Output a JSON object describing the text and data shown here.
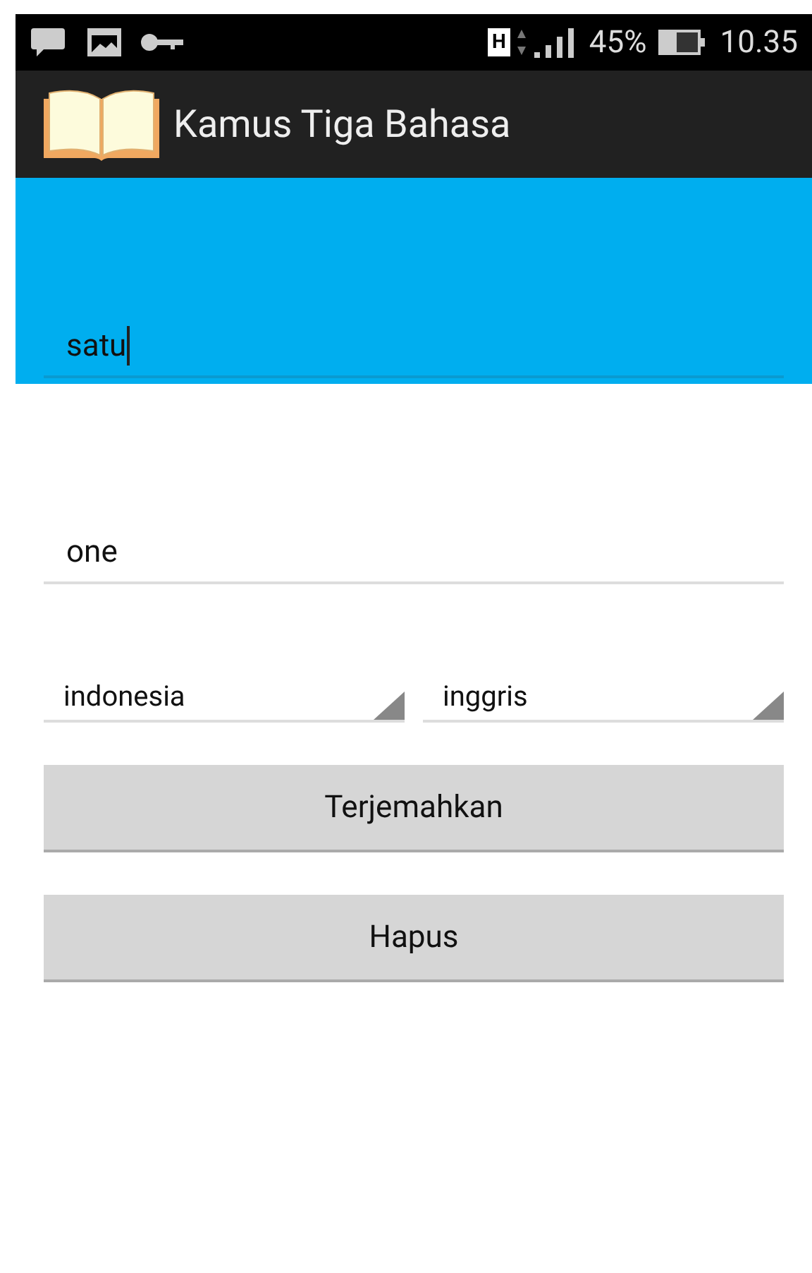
{
  "status_bar": {
    "network": "H",
    "battery": "45%",
    "time": "10.35"
  },
  "app_bar": {
    "title": "Kamus Tiga Bahasa"
  },
  "fields": [
    {
      "value": "satu",
      "focused": true
    },
    {
      "value": "one",
      "focused": false
    }
  ],
  "spinners": [
    {
      "value": "indonesia"
    },
    {
      "value": "inggris"
    }
  ],
  "buttons": [
    "Terjemahkan",
    "Hapus"
  ]
}
